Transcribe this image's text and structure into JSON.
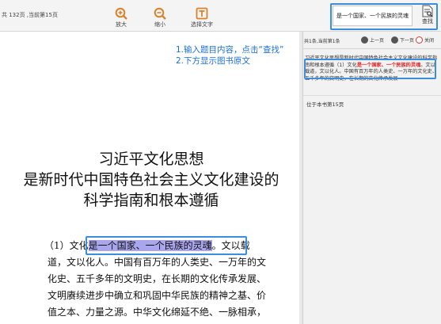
{
  "toolbar": {
    "page_info": "共 132页 ,当前第15页",
    "zoom_in_label": "放大",
    "zoom_out_label": "缩小",
    "select_text_label": "选择文字"
  },
  "search": {
    "query": "是一个国家、一个民族的灵魂",
    "button_label": "查找"
  },
  "annotation": {
    "line1": "1.输入题目内容，点击“查找”",
    "line2": "2.下方显示图书原文"
  },
  "document": {
    "title_lines": [
      "习近平文化思想",
      "是新时代中国特色社会主义文化建设的",
      "科学指南和根本遵循"
    ],
    "para_line1_pre": "（1）文化",
    "para_line1_hl": "是一个国家、一个民族的灵魂",
    "para_line1_post": "。文以载",
    "para_lines": [
      "道，文以化人。中国有百万年的人类史、一万年的文",
      "化史、五千多年的文明史，在长期的文化传承发展、",
      "文明赓续进步中确立和巩固中华民族的精神之基、价",
      "值之本、力量之源。中华文化绵延不绝、一脉相承，"
    ]
  },
  "result_panel": {
    "count": "共1条,当前第1条",
    "prev_label": "上一页",
    "next_label": "下一页",
    "close_label": "关闭",
    "text_before": "习近平文化思想是新时代中国特色社会主义文化建设的科学指南和根本遵循（1）文化",
    "text_match": "是一个国家、一个民族的灵魂",
    "text_after": "。文以载道，文以化人。中国有百万年的人类史、一万年的文化史、五千多年的文明史，在长期的文化传承发展",
    "page_location": "位于本书第15页"
  },
  "colors": {
    "highlight_box": "#3b8ddd",
    "annotation": "#1a6fd8",
    "match_red": "#e02020",
    "text_highlight": "#a9a6ee"
  }
}
